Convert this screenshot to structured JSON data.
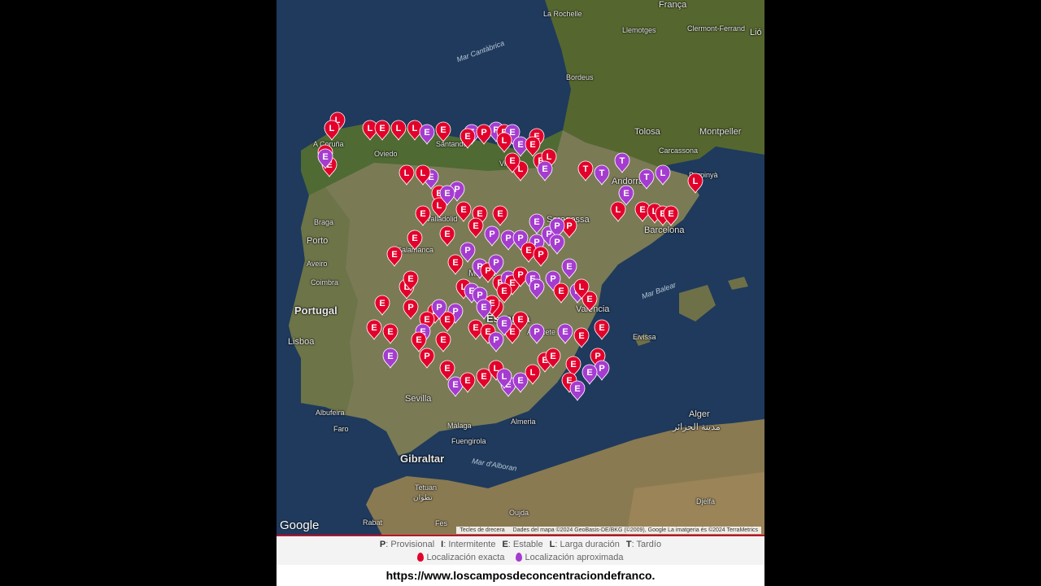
{
  "places": [
    {
      "name": "La Rochelle"
    },
    {
      "name": "Llemotges"
    },
    {
      "name": "Clermont-Ferrand"
    },
    {
      "name": "Bordeus"
    },
    {
      "name": "Tolosa"
    },
    {
      "name": "Montpeller"
    },
    {
      "name": "Carcassona"
    },
    {
      "name": "Perpinyà"
    },
    {
      "name": "Andorra"
    },
    {
      "name": "Barcelona"
    },
    {
      "name": "A Coruña"
    },
    {
      "name": "Oviedo"
    },
    {
      "name": "Santander"
    },
    {
      "name": "Vitòria"
    },
    {
      "name": "Valladolid"
    },
    {
      "name": "Saragossa"
    },
    {
      "name": "Braga"
    },
    {
      "name": "Porto"
    },
    {
      "name": "Salamanca"
    },
    {
      "name": "Aveiro"
    },
    {
      "name": "Coimbra"
    },
    {
      "name": "Madrid"
    },
    {
      "name": "Espanya"
    },
    {
      "name": "Portugal"
    },
    {
      "name": "València"
    },
    {
      "name": "Lisboa"
    },
    {
      "name": "Albacete"
    },
    {
      "name": "Eivissa"
    },
    {
      "name": "Albufeira"
    },
    {
      "name": "Faro"
    },
    {
      "name": "Sevilla"
    },
    {
      "name": "Màlaga"
    },
    {
      "name": "Almeria"
    },
    {
      "name": "Fuengirola"
    },
    {
      "name": "Gibraltar"
    },
    {
      "name": "Tetuan"
    },
    {
      "name": "Alger"
    },
    {
      "name": "مدينة الجزائر"
    },
    {
      "name": "Oujda"
    },
    {
      "name": "Rabat"
    },
    {
      "name": "Fes"
    },
    {
      "name": "Djelfa"
    },
    {
      "name": "França"
    },
    {
      "name": "Lió"
    },
    {
      "name": "تطوان"
    }
  ],
  "seas": [
    {
      "name": "Mar Cantàbrica"
    },
    {
      "name": "Mar Balear"
    },
    {
      "name": "Mar d'Alboran"
    }
  ],
  "google_logo": "Google",
  "attribution": {
    "keys": "Tecles de drecera",
    "data": "Dades del mapa ©2024 GeoBasis-DE/BKG (©2009), Google La imatgeria és ©2024 TerraMetrics"
  },
  "legend": {
    "types": [
      {
        "code": "P",
        "label": "Provisional"
      },
      {
        "code": "I",
        "label": "Intermitente"
      },
      {
        "code": "E",
        "label": "Estable"
      },
      {
        "code": "L",
        "label": "Larga duración"
      },
      {
        "code": "T",
        "label": "Tardío"
      }
    ],
    "exact": {
      "label": "Localización exacta",
      "color": "#e3002b"
    },
    "approx": {
      "label": "Localización aproximada",
      "color": "#a53cd0"
    }
  },
  "url": "https://www.loscamposdeconcentraciondefranco.",
  "colors": {
    "red_pin": "#e3002b",
    "purple_pin": "#a53cd0",
    "accent_line": "#c0102a"
  },
  "markers": [
    {
      "l": "L",
      "c": "r"
    },
    {
      "l": "L",
      "c": "r"
    },
    {
      "l": "E",
      "c": "r"
    },
    {
      "l": "E",
      "c": "r"
    },
    {
      "l": "E",
      "c": "p"
    },
    {
      "l": "L",
      "c": "r"
    },
    {
      "l": "E",
      "c": "r"
    },
    {
      "l": "L",
      "c": "r"
    },
    {
      "l": "L",
      "c": "r"
    },
    {
      "l": "E",
      "c": "p"
    },
    {
      "l": "E",
      "c": "p"
    },
    {
      "l": "E",
      "c": "r"
    },
    {
      "l": "E",
      "c": "r"
    },
    {
      "l": "P",
      "c": "p"
    },
    {
      "l": "E",
      "c": "r"
    },
    {
      "l": "E",
      "c": "p"
    },
    {
      "l": "P",
      "c": "r"
    },
    {
      "l": "E",
      "c": "p"
    },
    {
      "l": "L",
      "c": "r"
    },
    {
      "l": "E",
      "c": "r"
    },
    {
      "l": "E",
      "c": "r"
    },
    {
      "l": "E",
      "c": "r"
    },
    {
      "l": "L",
      "c": "r"
    },
    {
      "l": "E",
      "c": "p"
    },
    {
      "l": "L",
      "c": "r"
    },
    {
      "l": "E",
      "c": "r"
    },
    {
      "l": "L",
      "c": "r"
    },
    {
      "l": "T",
      "c": "r"
    },
    {
      "l": "T",
      "c": "p"
    },
    {
      "l": "T",
      "c": "p"
    },
    {
      "l": "T",
      "c": "p"
    },
    {
      "l": "L",
      "c": "p"
    },
    {
      "l": "L",
      "c": "r"
    },
    {
      "l": "E",
      "c": "p"
    },
    {
      "l": "L",
      "c": "r"
    },
    {
      "l": "E",
      "c": "r"
    },
    {
      "l": "L",
      "c": "r"
    },
    {
      "l": "E",
      "c": "r"
    },
    {
      "l": "E",
      "c": "r"
    },
    {
      "l": "E",
      "c": "p"
    },
    {
      "l": "L",
      "c": "r"
    },
    {
      "l": "E",
      "c": "r"
    },
    {
      "l": "L",
      "c": "r"
    },
    {
      "l": "E",
      "c": "r"
    },
    {
      "l": "E",
      "c": "r"
    },
    {
      "l": "E",
      "c": "r"
    },
    {
      "l": "P",
      "c": "p"
    },
    {
      "l": "E",
      "c": "p"
    },
    {
      "l": "E",
      "c": "r"
    },
    {
      "l": "E",
      "c": "r"
    },
    {
      "l": "E",
      "c": "r"
    },
    {
      "l": "P",
      "c": "p"
    },
    {
      "l": "E",
      "c": "r"
    },
    {
      "l": "P",
      "c": "p"
    },
    {
      "l": "P",
      "c": "p"
    },
    {
      "l": "P",
      "c": "p"
    },
    {
      "l": "P",
      "c": "p"
    },
    {
      "l": "E",
      "c": "p"
    },
    {
      "l": "P",
      "c": "r"
    },
    {
      "l": "P",
      "c": "p"
    },
    {
      "l": "P",
      "c": "p"
    },
    {
      "l": "E",
      "c": "r"
    },
    {
      "l": "P",
      "c": "r"
    },
    {
      "l": "E",
      "c": "r"
    },
    {
      "l": "L",
      "c": "r"
    },
    {
      "l": "E",
      "c": "r"
    },
    {
      "l": "P",
      "c": "p"
    },
    {
      "l": "P",
      "c": "p"
    },
    {
      "l": "P",
      "c": "r"
    },
    {
      "l": "P",
      "c": "p"
    },
    {
      "l": "P",
      "c": "r"
    },
    {
      "l": "P",
      "c": "p"
    },
    {
      "l": "E",
      "c": "r"
    },
    {
      "l": "P",
      "c": "r"
    },
    {
      "l": "E",
      "c": "p"
    },
    {
      "l": "P",
      "c": "p"
    },
    {
      "l": "P",
      "c": "p"
    },
    {
      "l": "E",
      "c": "p"
    },
    {
      "l": "E",
      "c": "r"
    },
    {
      "l": "P",
      "c": "p"
    },
    {
      "l": "E",
      "c": "r"
    },
    {
      "l": "L",
      "c": "r"
    },
    {
      "l": "L",
      "c": "r"
    },
    {
      "l": "E",
      "c": "p"
    },
    {
      "l": "P",
      "c": "p"
    },
    {
      "l": "P",
      "c": "r"
    },
    {
      "l": "E",
      "c": "r"
    },
    {
      "l": "E",
      "c": "r"
    },
    {
      "l": "E",
      "c": "p"
    },
    {
      "l": "P",
      "c": "p"
    },
    {
      "l": "E",
      "c": "r"
    },
    {
      "l": "E",
      "c": "r"
    },
    {
      "l": "P",
      "c": "p"
    },
    {
      "l": "E",
      "c": "r"
    },
    {
      "l": "P",
      "c": "r"
    },
    {
      "l": "E",
      "c": "p"
    },
    {
      "l": "E",
      "c": "r"
    },
    {
      "l": "E",
      "c": "r"
    },
    {
      "l": "E",
      "c": "r"
    },
    {
      "l": "E",
      "c": "r"
    },
    {
      "l": "E",
      "c": "r"
    },
    {
      "l": "E",
      "c": "p"
    },
    {
      "l": "P",
      "c": "r"
    },
    {
      "l": "E",
      "c": "r"
    },
    {
      "l": "E",
      "c": "r"
    },
    {
      "l": "E",
      "c": "r"
    },
    {
      "l": "P",
      "c": "p"
    },
    {
      "l": "E",
      "c": "r"
    },
    {
      "l": "E",
      "c": "p"
    },
    {
      "l": "E",
      "c": "r"
    },
    {
      "l": "P",
      "c": "p"
    },
    {
      "l": "E",
      "c": "p"
    },
    {
      "l": "E",
      "c": "r"
    },
    {
      "l": "E",
      "c": "r"
    },
    {
      "l": "E",
      "c": "r"
    },
    {
      "l": "E",
      "c": "p"
    },
    {
      "l": "E",
      "c": "r"
    },
    {
      "l": "E",
      "c": "r"
    },
    {
      "l": "L",
      "c": "r"
    },
    {
      "l": "E",
      "c": "p"
    },
    {
      "l": "L",
      "c": "p"
    },
    {
      "l": "E",
      "c": "p"
    },
    {
      "l": "L",
      "c": "r"
    },
    {
      "l": "E",
      "c": "r"
    },
    {
      "l": "E",
      "c": "r"
    },
    {
      "l": "E",
      "c": "r"
    },
    {
      "l": "E",
      "c": "r"
    },
    {
      "l": "E",
      "c": "p"
    },
    {
      "l": "P",
      "c": "r"
    },
    {
      "l": "P",
      "c": "p"
    },
    {
      "l": "E",
      "c": "p"
    }
  ]
}
